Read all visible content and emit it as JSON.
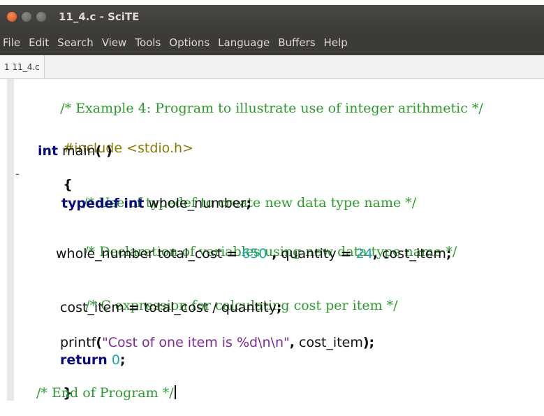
{
  "window": {
    "title": "11_4.c - SciTE"
  },
  "menubar": {
    "items": [
      "File",
      "Edit",
      "Search",
      "View",
      "Tools",
      "Options",
      "Language",
      "Buffers",
      "Help"
    ]
  },
  "tabs": [
    {
      "label": "1 11_4.c"
    }
  ],
  "editor": {
    "fold_marker": "-",
    "lines": {
      "l1": "/* Example 4: Program to illustrate use of integer arithmetic */",
      "l2": "#include <stdio.h>",
      "l3_kw": "int",
      "l3_rest": " main",
      "l3_paren": "( )",
      "l4": "{",
      "l5": "/* Use of typedef to create new data type name */",
      "l6_kw": "typedef int",
      "l6_rest": " whole_number",
      "l6_semi": ";",
      "l7": "/* Declaration of variables using new data type name */",
      "l8_a": "whole_number total_cost ",
      "l8_eq": "=",
      "l8_n1": "650",
      "l8_comma1": " ,",
      "l8_b": " quantity ",
      "l8_eq2": "=",
      "l8_n2": "24",
      "l8_comma2": ",",
      "l8_c": " cost_item",
      "l8_semi": ";",
      "l9": "/* C expression for calculating cost per item */",
      "l10_a": "cost_item ",
      "l10_eq": "=",
      "l10_b": " total_cost / quantity",
      "l10_semi": ";",
      "l11_a": "printf",
      "l11_paren": "(",
      "l11_str": "\"Cost of one item is %d\\n\\n\"",
      "l11_comma": ",",
      "l11_b": " cost_item",
      "l11_end": ");",
      "l12_kw": "return",
      "l12_num": "0",
      "l12_semi": ";",
      "l13": "}",
      "l14": "/* End of Program */"
    }
  },
  "colors": {
    "comment": "#2c9a2c",
    "preprocessor": "#8a7a00",
    "keyword": "#0b0b80",
    "number": "#1aa6a6",
    "string": "#7b2a9a",
    "titlebar": "#3c3b37"
  }
}
